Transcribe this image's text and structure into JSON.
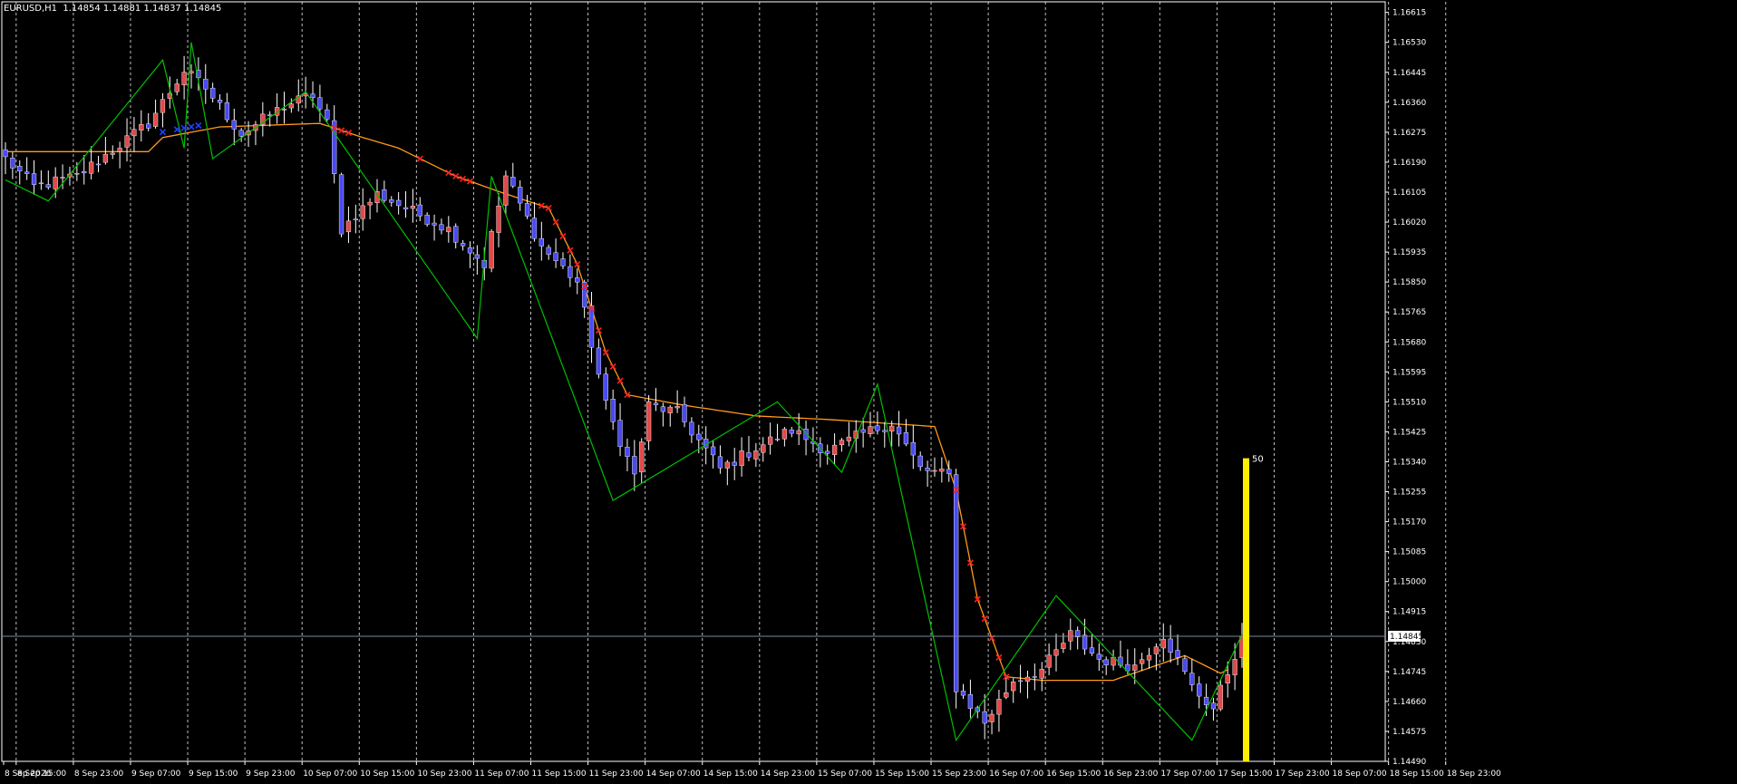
{
  "title": {
    "symbol": "EURUSD,H1",
    "ohlc": "1.14854 1.14881 1.14837 1.14845"
  },
  "colors": {
    "background": "#000000",
    "frame": "#ffffff",
    "grid": "#ffffff",
    "bull_candle": "#e04a4a",
    "bear_candle": "#4a4af0",
    "wick": "#ffffff",
    "zigzag": "#00c000",
    "moving_average": "#ff9a1a",
    "signal_red": "#ff2020",
    "signal_blue": "#2040ff",
    "bid_line": "#7a8a99",
    "volume_bar": "#ffee00",
    "price_tag_bg": "#ffffff",
    "price_tag_text": "#000000"
  },
  "chart_data": {
    "type": "candlestick",
    "symbol": "EURUSD",
    "timeframe": "H1",
    "y_ticks": [
      "1.16615",
      "1.16530",
      "1.16445",
      "1.16360",
      "1.16275",
      "1.16190",
      "1.16105",
      "1.16020",
      "1.15935",
      "1.15850",
      "1.15765",
      "1.15680",
      "1.15595",
      "1.15510",
      "1.15425",
      "1.15340",
      "1.15255",
      "1.15170",
      "1.15085",
      "1.15000",
      "1.14915",
      "1.14830",
      "1.14745",
      "1.14660",
      "1.14575",
      "1.14490"
    ],
    "ylim": [
      1.1449,
      1.16645
    ],
    "x_ticks": [
      "8 Sep 2026",
      "8 Sep 15:00",
      "8 Sep 23:00",
      "9 Sep 07:00",
      "9 Sep 15:00",
      "9 Sep 23:00",
      "10 Sep 07:00",
      "10 Sep 15:00",
      "10 Sep 23:00",
      "11 Sep 07:00",
      "11 Sep 15:00",
      "11 Sep 23:00",
      "14 Sep 07:00",
      "14 Sep 15:00",
      "14 Sep 23:00",
      "15 Sep 07:00",
      "15 Sep 15:00",
      "15 Sep 23:00",
      "16 Sep 07:00",
      "16 Sep 15:00",
      "16 Sep 23:00",
      "17 Sep 07:00",
      "17 Sep 15:00",
      "17 Sep 23:00",
      "18 Sep 07:00",
      "18 Sep 15:00",
      "18 Sep 23:00"
    ],
    "separators": [
      2,
      17,
      32,
      47,
      62,
      77,
      92,
      107
    ],
    "bar_count": 174,
    "close_anchors": [
      [
        0,
        1.162
      ],
      [
        4,
        1.1612
      ],
      [
        10,
        1.1615
      ],
      [
        20,
        1.163
      ],
      [
        25,
        1.1645
      ],
      [
        28,
        1.164
      ],
      [
        33,
        1.1627
      ],
      [
        39,
        1.1635
      ],
      [
        43,
        1.1638
      ],
      [
        45,
        1.163
      ],
      [
        47,
        1.16
      ],
      [
        52,
        1.161
      ],
      [
        57,
        1.1605
      ],
      [
        62,
        1.16
      ],
      [
        67,
        1.159
      ],
      [
        70,
        1.1615
      ],
      [
        75,
        1.1595
      ],
      [
        80,
        1.1585
      ],
      [
        84,
        1.155
      ],
      [
        88,
        1.153
      ],
      [
        90,
        1.155
      ],
      [
        94,
        1.1548
      ],
      [
        100,
        1.1532
      ],
      [
        105,
        1.1538
      ],
      [
        110,
        1.1543
      ],
      [
        115,
        1.1537
      ],
      [
        120,
        1.1542
      ],
      [
        124,
        1.1545
      ],
      [
        128,
        1.1532
      ],
      [
        132,
        1.153
      ],
      [
        133,
        1.147
      ],
      [
        137,
        1.146
      ],
      [
        141,
        1.1472
      ],
      [
        145,
        1.1475
      ],
      [
        149,
        1.1485
      ],
      [
        153,
        1.1478
      ],
      [
        158,
        1.1476
      ],
      [
        162,
        1.1485
      ],
      [
        166,
        1.147
      ],
      [
        169,
        1.1464
      ],
      [
        173,
        1.14845
      ]
    ],
    "zigzag_points": [
      [
        0,
        1.1614
      ],
      [
        6,
        1.1608
      ],
      [
        22,
        1.1648
      ],
      [
        25,
        1.1623
      ],
      [
        26,
        1.1653
      ],
      [
        29,
        1.162
      ],
      [
        42,
        1.1639
      ],
      [
        66,
        1.1569
      ],
      [
        68,
        1.1615
      ],
      [
        85,
        1.1523
      ],
      [
        108,
        1.1551
      ],
      [
        117,
        1.1531
      ],
      [
        122,
        1.1556
      ],
      [
        133,
        1.1455
      ],
      [
        147,
        1.1496
      ],
      [
        166,
        1.1455
      ],
      [
        173,
        1.1485
      ]
    ],
    "ma_anchors": [
      [
        0,
        1.1622
      ],
      [
        20,
        1.1622
      ],
      [
        22,
        1.1626
      ],
      [
        30,
        1.1629
      ],
      [
        44,
        1.163
      ],
      [
        50,
        1.1626
      ],
      [
        55,
        1.1623
      ],
      [
        63,
        1.1615
      ],
      [
        70,
        1.161
      ],
      [
        76,
        1.1606
      ],
      [
        80,
        1.159
      ],
      [
        84,
        1.1565
      ],
      [
        87,
        1.1553
      ],
      [
        95,
        1.155
      ],
      [
        105,
        1.1547
      ],
      [
        115,
        1.1546
      ],
      [
        130,
        1.1544
      ],
      [
        133,
        1.1526
      ],
      [
        136,
        1.1495
      ],
      [
        140,
        1.1473
      ],
      [
        145,
        1.1472
      ],
      [
        155,
        1.1472
      ],
      [
        165,
        1.1479
      ],
      [
        168,
        1.1476
      ],
      [
        170,
        1.1474
      ],
      [
        171,
        1.1475
      ]
    ],
    "signals_red": [
      46,
      47,
      48,
      58,
      62,
      63,
      64,
      65,
      75,
      76,
      77,
      78,
      79,
      80,
      81,
      82,
      83,
      84,
      85,
      86,
      87,
      133,
      134,
      135,
      136,
      137,
      138,
      139,
      140
    ],
    "signals_blue": [
      22,
      24,
      25,
      26,
      27
    ],
    "bid_price": "1.14845",
    "volume_bar": {
      "value_label": "50",
      "top_price": 1.1535
    }
  }
}
